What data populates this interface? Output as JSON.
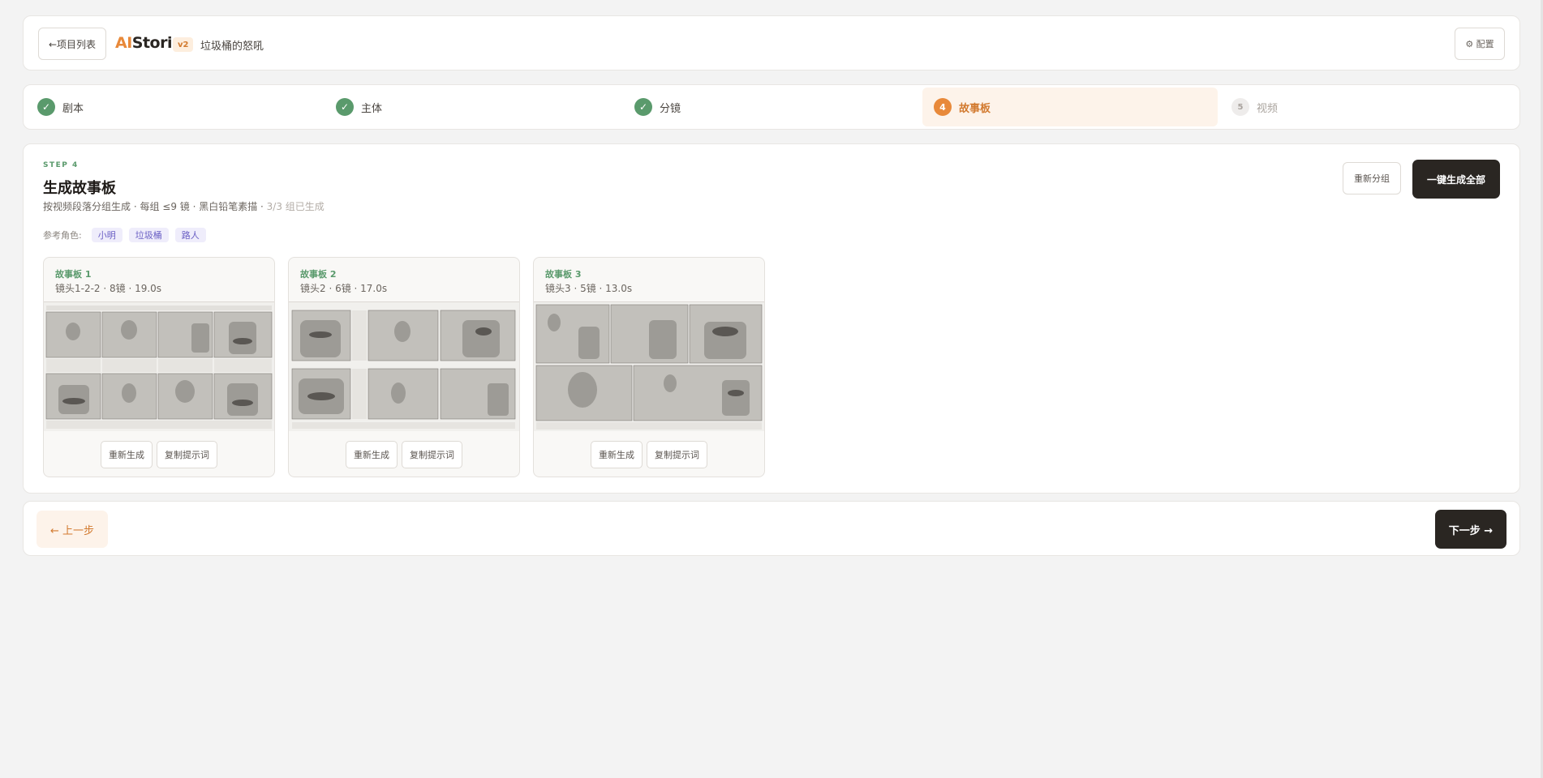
{
  "header": {
    "back_label": "←项目列表",
    "logo_ai": "AI",
    "logo_rest": "Stori",
    "version": "v2",
    "project_name": "垃圾桶的怒吼",
    "config_icon": "gear-icon",
    "config_label": "⚙ 配置"
  },
  "steps": [
    {
      "number": "✓",
      "label": "剧本",
      "status": "done"
    },
    {
      "number": "✓",
      "label": "主体",
      "status": "done"
    },
    {
      "number": "✓",
      "label": "分镜",
      "status": "done"
    },
    {
      "number": "4",
      "label": "故事板",
      "status": "active"
    },
    {
      "number": "5",
      "label": "视频",
      "status": "pending"
    }
  ],
  "main": {
    "step_tag": "STEP 4",
    "title": "生成故事板",
    "subtitle": "按视频段落分组生成 · 每组 ≤9 镜 · 黑白铅笔素描 · ",
    "subtitle_status": "3/3 组已生成",
    "ref_label": "参考角色:",
    "ref_chips": [
      "小明",
      "垃圾桶",
      "路人"
    ],
    "regroup_label": "重新分组",
    "generate_all_label": "一键生成全部"
  },
  "boards": [
    {
      "title": "故事板 1",
      "meta": "镜头1-2-2 · 8镜 · 19.0s",
      "regen_label": "重新生成",
      "copy_label": "复制提示词"
    },
    {
      "title": "故事板 2",
      "meta": "镜头2 · 6镜 · 17.0s",
      "regen_label": "重新生成",
      "copy_label": "复制提示词"
    },
    {
      "title": "故事板 3",
      "meta": "镜头3 · 5镜 · 13.0s",
      "regen_label": "重新生成",
      "copy_label": "复制提示词"
    }
  ],
  "footer": {
    "prev_label": "← 上一步",
    "next_label": "下一步 →"
  },
  "colors": {
    "accent_orange": "#e8893a",
    "done_green": "#5a9a6c",
    "dark_button": "#2a2622",
    "chip_purple": "#6a5fc4"
  }
}
